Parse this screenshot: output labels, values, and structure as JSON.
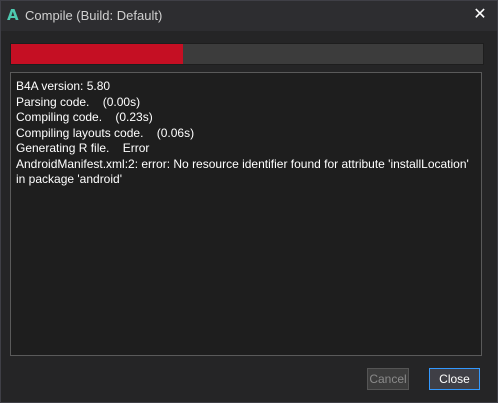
{
  "window": {
    "app_icon_glyph": "A",
    "title": "Compile (Build: Default)",
    "close_glyph": "✕"
  },
  "progress": {
    "value_percent": 36.5,
    "fill_color": "#c50f23",
    "track_color": "#3c3c3c"
  },
  "log": {
    "lines": [
      "B4A version: 5.80",
      "Parsing code.    (0.00s)",
      "Compiling code.    (0.23s)",
      "Compiling layouts code.    (0.06s)",
      "Generating R file.    Error",
      "AndroidManifest.xml:2: error: No resource identifier found for attribute 'installLocation'",
      "in package 'android'"
    ]
  },
  "buttons": {
    "cancel_label": "Cancel",
    "cancel_enabled": false,
    "close_label": "Close"
  },
  "colors": {
    "accent": "#3399ff",
    "app_icon": "#4ec9b0"
  }
}
